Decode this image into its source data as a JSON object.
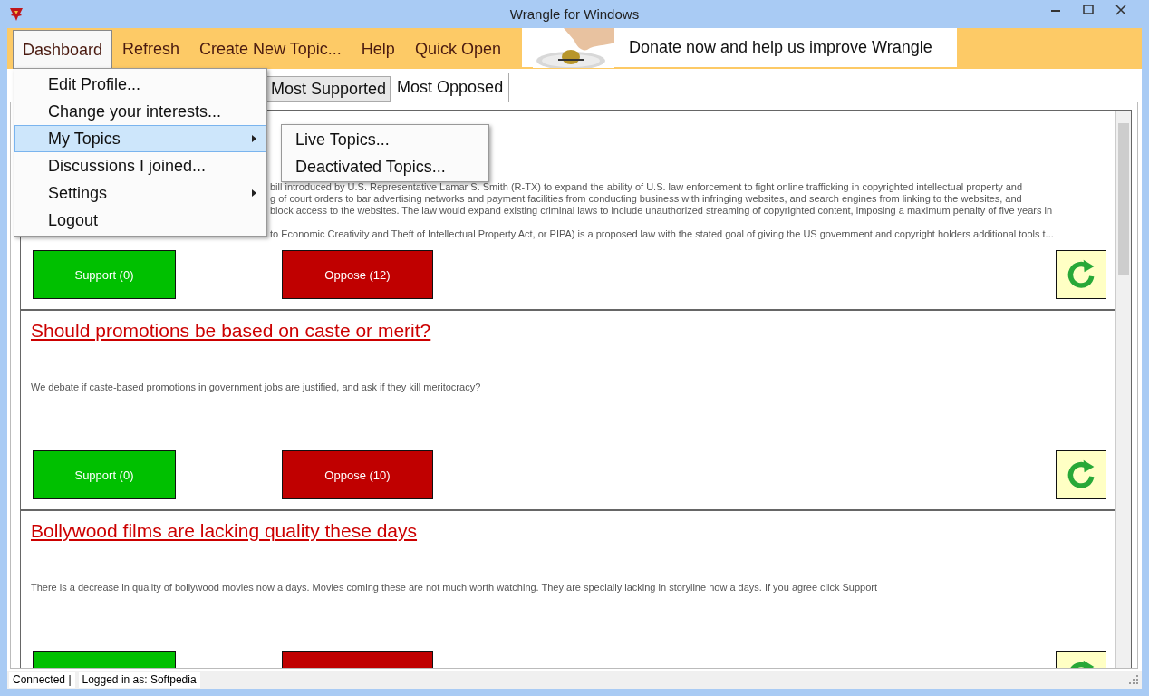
{
  "window": {
    "title": "Wrangle for Windows"
  },
  "menu_bar": [
    {
      "label": "Dashboard",
      "selected": true
    },
    {
      "label": "Refresh",
      "selected": false
    },
    {
      "label": "Create New Topic...",
      "selected": false
    },
    {
      "label": "Help",
      "selected": false
    },
    {
      "label": "Quick Open",
      "selected": false
    }
  ],
  "donate_banner": {
    "text": "Donate now and help us improve Wrangle"
  },
  "dashboard_menu": [
    {
      "label": "Edit Profile...",
      "selected": false,
      "submenu": false
    },
    {
      "label": "Change your interests...",
      "selected": false,
      "submenu": false
    },
    {
      "label": "My Topics",
      "selected": true,
      "submenu": true
    },
    {
      "label": "Discussions I joined...",
      "selected": false,
      "submenu": false
    },
    {
      "label": "Settings",
      "selected": false,
      "submenu": true
    },
    {
      "label": "Logout",
      "selected": false,
      "submenu": false
    }
  ],
  "my_topics_submenu": [
    "Live Topics...",
    "Deactivated Topics..."
  ],
  "tabs": [
    {
      "label": "Most Supported",
      "selected": false
    },
    {
      "label": "Most Opposed",
      "selected": true
    }
  ],
  "topics": [
    {
      "paragraphs": [
        [
          "bill introduced by U.S. Representative Lamar S. Smith (R-TX) to expand the ability of U.S. law enforcement to fight online trafficking in copyrighted intellectual property and",
          "g of court orders to bar advertising networks and payment facilities from conducting business with infringing websites, and search engines from linking to the websites, and",
          "block access to the websites. The law would expand existing criminal laws to include unauthorized streaming of copyrighted content, imposing a maximum penalty of five years in"
        ],
        [
          "to Economic Creativity and Theft of Intellectual Property Act, or PIPA) is a proposed law with the stated goal of giving the US government and copyright holders additional tools t..."
        ]
      ],
      "support": "Support (0)",
      "oppose": "Oppose (12)"
    },
    {
      "title": "Should promotions be based on caste or merit?",
      "paragraphs": [
        [
          "We debate if caste-based promotions in government jobs are justified, and ask if they kill meritocracy?"
        ]
      ],
      "support": "Support (0)",
      "oppose": "Oppose (10)"
    },
    {
      "title": "Bollywood films are lacking quality these days",
      "paragraphs": [
        [
          "There is a decrease in quality of bollywood movies now a days. Movies coming these are not much worth watching. They are specially lacking in storyline now a days. If you agree click Support"
        ]
      ]
    }
  ],
  "status_bar": {
    "connection": "Connected |",
    "user": "Logged in as: Softpedia"
  }
}
